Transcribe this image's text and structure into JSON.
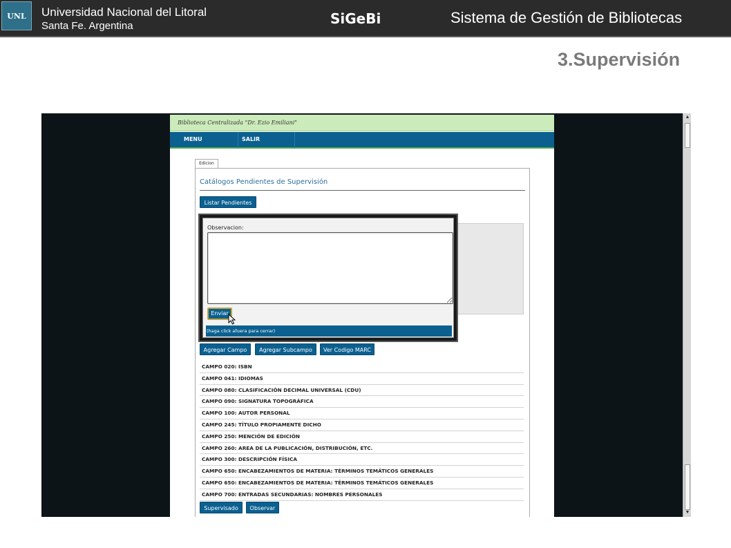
{
  "slide": {
    "logo_text": "UNL",
    "university": "Universidad Nacional del Litoral",
    "city": "Santa Fe. Argentina",
    "acronym": "SiGeBi",
    "system": "Sistema de Gestión de Bibliotecas",
    "section": "3.Supervisión"
  },
  "app": {
    "library_name": "Biblioteca Centralizada \"Dr. Ezio Emiliani\"",
    "nav": {
      "menu": "MENU",
      "exit": "SALIR"
    },
    "tab": "Edicion",
    "panel_title": "Catálogos Pendientes de Supervisión",
    "list_pending": "Listar Pendientes",
    "actions": {
      "add_field": "Agregar Campo",
      "add_subfield": "Agregar Subcampo",
      "view_marc": "Ver Codigo MARC"
    },
    "fields": [
      "CAMPO 020: ISBN",
      "CAMPO 041: IDIOMAS",
      "CAMPO 080: CLASIFICACIÓN DECIMAL UNIVERSAL (CDU)",
      "CAMPO 090: SIGNATURA TOPOGRÁFICA",
      "CAMPO 100: AUTOR PERSONAL",
      "CAMPO 245: TÍTULO PROPIAMENTE DICHO",
      "CAMPO 250: MENCIÓN DE EDICIÓN",
      "CAMPO 260: AREA DE LA PUBLICACIÓN, DISTRIBUCIÓN, ETC.",
      "CAMPO 300: DESCRIPCIÓN FÍSICA",
      "CAMPO 650: ENCABEZAMIENTOS DE MATERIA: TÉRMINOS TEMÁTICOS GENERALES",
      "CAMPO 650: ENCABEZAMIENTOS DE MATERIA: TÉRMINOS TEMÁTICOS GENERALES",
      "CAMPO 700: ENTRADAS SECUNDARIAS: NOMBRES PERSONALES"
    ],
    "supervised": "Supervisado",
    "observe": "Observar"
  },
  "modal": {
    "label": "Observacion:",
    "value": "",
    "send": "Enviar",
    "close_hint": "(haga click afuera para cerrar)"
  },
  "colors": {
    "header_bg": "#2b2b2b",
    "nav_blue": "#0b6090",
    "lib_green": "#ccebbb",
    "section_gray": "#7a7a7a"
  }
}
